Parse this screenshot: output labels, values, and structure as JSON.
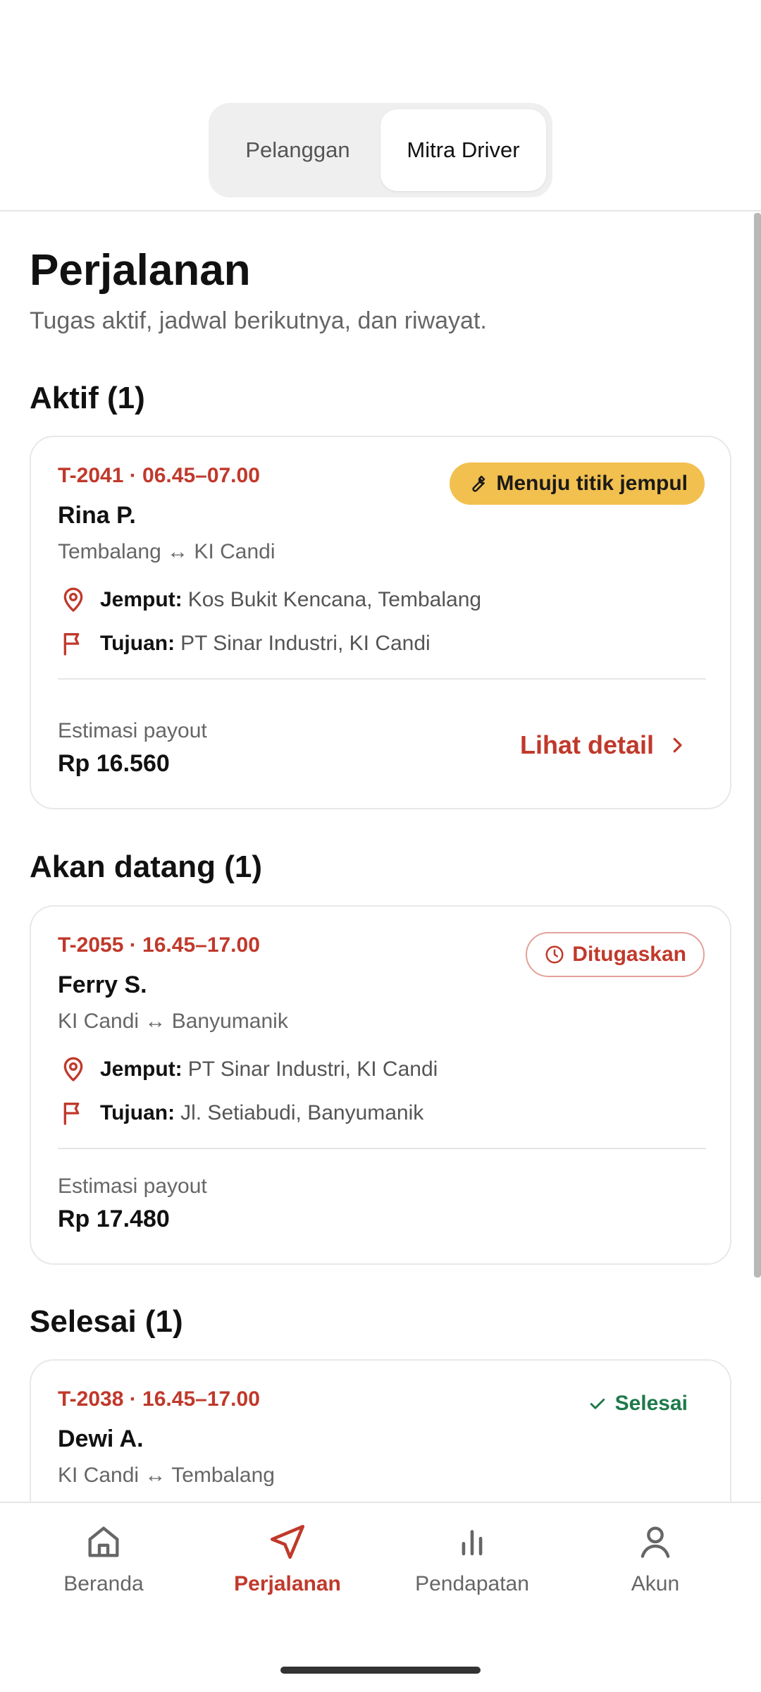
{
  "segment": {
    "options": [
      "Pelanggan",
      "Mitra Driver"
    ],
    "active": "Mitra Driver"
  },
  "page": {
    "title": "Perjalanan",
    "subtitle": "Tugas aktif, jadwal berikutnya, dan riwayat."
  },
  "sections": {
    "active": {
      "title": "Aktif (1)",
      "trip": {
        "code": "T-2041 · 06.45–07.00",
        "name": "Rina P.",
        "route": "Tembalang ↔ KI Candi",
        "pickup_label": "Jemput:",
        "pickup": "Kos Bukit Kencana, Tembalang",
        "dest_label": "Tujuan:",
        "dest": "PT Sinar Industri, KI Candi",
        "status": "Menuju titik jempul",
        "status_icon": "wrench-icon",
        "payout_label": "Estimasi payout",
        "payout": "Rp 16.560",
        "detail_link": "Lihat detail"
      }
    },
    "upcoming": {
      "title": "Akan datang (1)",
      "trip": {
        "code": "T-2055 · 16.45–17.00",
        "name": "Ferry S.",
        "route": "KI Candi ↔ Banyumanik",
        "pickup_label": "Jemput:",
        "pickup": "PT Sinar Industri, KI Candi",
        "dest_label": "Tujuan:",
        "dest": "Jl. Setiabudi, Banyumanik",
        "status": "Ditugaskan",
        "status_icon": "clock-icon",
        "payout_label": "Estimasi payout",
        "payout": "Rp 17.480"
      }
    },
    "done": {
      "title": "Selesai (1)",
      "trip": {
        "code": "T-2038 · 16.45–17.00",
        "name": "Dewi A.",
        "route": "KI Candi ↔ Tembalang",
        "status": "Selesai",
        "status_icon": "check-icon"
      }
    }
  },
  "bottom_nav": {
    "items": [
      {
        "label": "Beranda",
        "icon": "home-icon"
      },
      {
        "label": "Perjalanan",
        "icon": "navigation-icon"
      },
      {
        "label": "Pendapatan",
        "icon": "bar-chart-icon"
      },
      {
        "label": "Akun",
        "icon": "user-icon"
      }
    ],
    "active": "Perjalanan"
  },
  "colors": {
    "accent": "#c0392b",
    "status_yellow": "#f2c04f",
    "success": "#1e7a4a"
  }
}
